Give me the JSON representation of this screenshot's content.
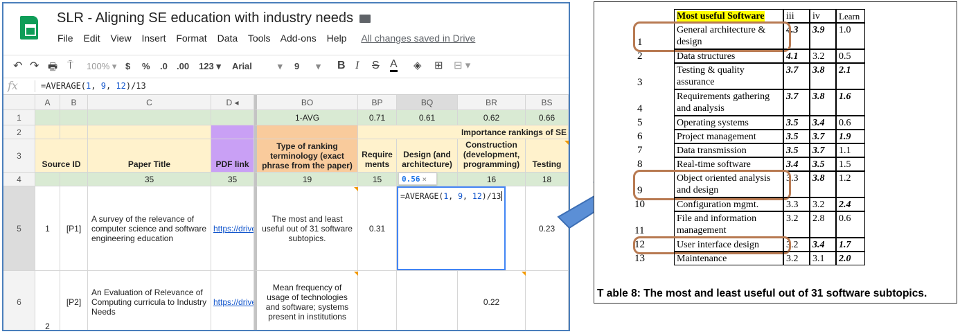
{
  "sheet": {
    "title": "SLR - Aligning SE education with industry needs",
    "menu": [
      "File",
      "Edit",
      "View",
      "Insert",
      "Format",
      "Data",
      "Tools",
      "Add-ons",
      "Help"
    ],
    "saved_status": "All changes saved in Drive",
    "toolbar": {
      "zoom": "100%",
      "currency": "$",
      "percent": "%",
      "dec_less": ".0",
      "dec_more": ".00",
      "format": "123",
      "font": "Arial",
      "font_size": "9",
      "bold": "B",
      "italic": "I",
      "strike": "S",
      "text_color": "A"
    },
    "formula_bar": {
      "fx": "fx",
      "prefix": "=AVERAGE(",
      "n1": "1",
      "n2": "9",
      "n3": "12",
      "suffix": ")/13"
    },
    "columns": [
      "A",
      "B",
      "C",
      "D",
      "BO",
      "BP",
      "BQ",
      "BR",
      "BS"
    ],
    "rows": {
      "r1": {
        "num": "1",
        "bo": "1-AVG",
        "bp": "0.71",
        "bq": "0.61",
        "br": "0.62",
        "bs": "0.66"
      },
      "r2": {
        "num": "2",
        "group": "Importance rankings of SE"
      },
      "r3": {
        "num": "3",
        "source_id": "Source ID",
        "paper_title": "Paper Title",
        "pdf_link": "PDF link",
        "bo": "Type of ranking terminology (exact phrase from the paper)",
        "bp": "Require ments",
        "bq": "Design (and architecture)",
        "br": "Construction (development, programming)",
        "bs": "Testing"
      },
      "r4": {
        "num": "4",
        "c": "35",
        "d": "35",
        "bo": "19",
        "bp": "15",
        "br": "16",
        "bs": "18"
      },
      "r5": {
        "num": "5",
        "a": "1",
        "b": "[P1]",
        "c": "A survey of the relevance of computer science and software engineering education",
        "d": "https://drive",
        "bo": "The most and least useful out of 31 software subtopics.",
        "bp": "0.31",
        "bs": "0.23"
      },
      "r6": {
        "num": "6",
        "a": "2",
        "b": "[P2]",
        "c": "An Evaluation of Relevance of Computing curricula to Industry Needs",
        "d": "https://drive",
        "bo": "Mean frequency of usage of technologies and software; systems present in institutions",
        "br": "0.22"
      }
    },
    "editor_text": "=AVERAGE(1, 9, 12)/13",
    "tooltip_value": "0.56",
    "tooltip_close": "×"
  },
  "paper_table": {
    "headers": [
      "Most useful Software",
      "iii",
      "iv",
      "Learn"
    ],
    "rows": [
      {
        "idx": "1",
        "name": "General architecture & design",
        "iii": "4.3",
        "iv": "3.9",
        "learn": "1.0",
        "circled": true
      },
      {
        "idx": "2",
        "name": "Data structures",
        "iii": "4.1",
        "iv": "3.2",
        "learn": "0.5"
      },
      {
        "idx": "3",
        "name": "Testing & quality assurance",
        "iii": "3.7",
        "iv": "3.8",
        "learn": "2.1"
      },
      {
        "idx": "4",
        "name": "Requirements gathering and analysis",
        "iii": "3.7",
        "iv": "3.8",
        "learn": "1.6"
      },
      {
        "idx": "5",
        "name": "Operating systems",
        "iii": "3.5",
        "iv": "3.4",
        "learn": "0.6"
      },
      {
        "idx": "6",
        "name": "Project management",
        "iii": "3.5",
        "iv": "3.7",
        "learn": "1.9"
      },
      {
        "idx": "7",
        "name": "Data transmission",
        "iii": "3.5",
        "iv": "3.7",
        "learn": "1.1"
      },
      {
        "idx": "8",
        "name": "Real-time software",
        "iii": "3.4",
        "iv": "3.5",
        "learn": "1.5"
      },
      {
        "idx": "9",
        "name": "Object oriented analysis and design",
        "iii": "3.3",
        "iv": "3.8",
        "learn": "1.2",
        "circled": true
      },
      {
        "idx": "10",
        "name": "Configuration mgmt.",
        "iii": "3.3",
        "iv": "3.2",
        "learn": "2.4"
      },
      {
        "idx": "11",
        "name": "File and information management",
        "iii": "3.2",
        "iv": "2.8",
        "learn": "0.6"
      },
      {
        "idx": "12",
        "name": "User interface design",
        "iii": "3.2",
        "iv": "3.4",
        "learn": "1.7",
        "circled": true
      },
      {
        "idx": "13",
        "name": "Maintenance",
        "iii": "3.2",
        "iv": "3.1",
        "learn": "2.0"
      }
    ],
    "caption": "T able 8: The most and least useful out of 31 software subtopics."
  },
  "colors": {
    "sheets_green": "#0f9d58",
    "header_green": "#d9ead3",
    "header_tan": "#fce5cd",
    "header_purple": "#c9a0f5",
    "header_peach": "#f9cb9c",
    "selection_blue": "#4285f4",
    "arrow_blue": "#5b8fd6",
    "circle_brown": "#b87a52",
    "highlight_yellow": "#ffff00"
  }
}
